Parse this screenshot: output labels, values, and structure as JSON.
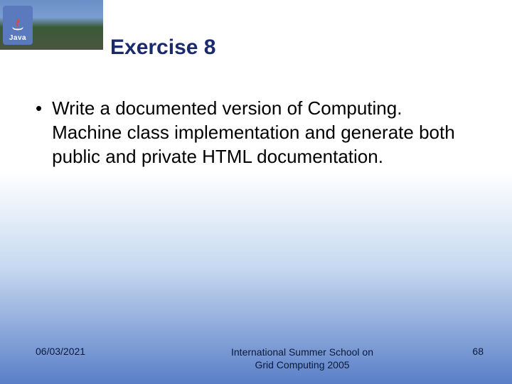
{
  "logo": {
    "label": "Java"
  },
  "title": "Exercise 8",
  "bullet": {
    "text": "Write a documented version of Computing. Machine class implementation and generate both public and private HTML documentation."
  },
  "footer": {
    "date": "06/03/2021",
    "center_line1": "International Summer School on",
    "center_line2": "Grid Computing 2005",
    "page": "68"
  }
}
